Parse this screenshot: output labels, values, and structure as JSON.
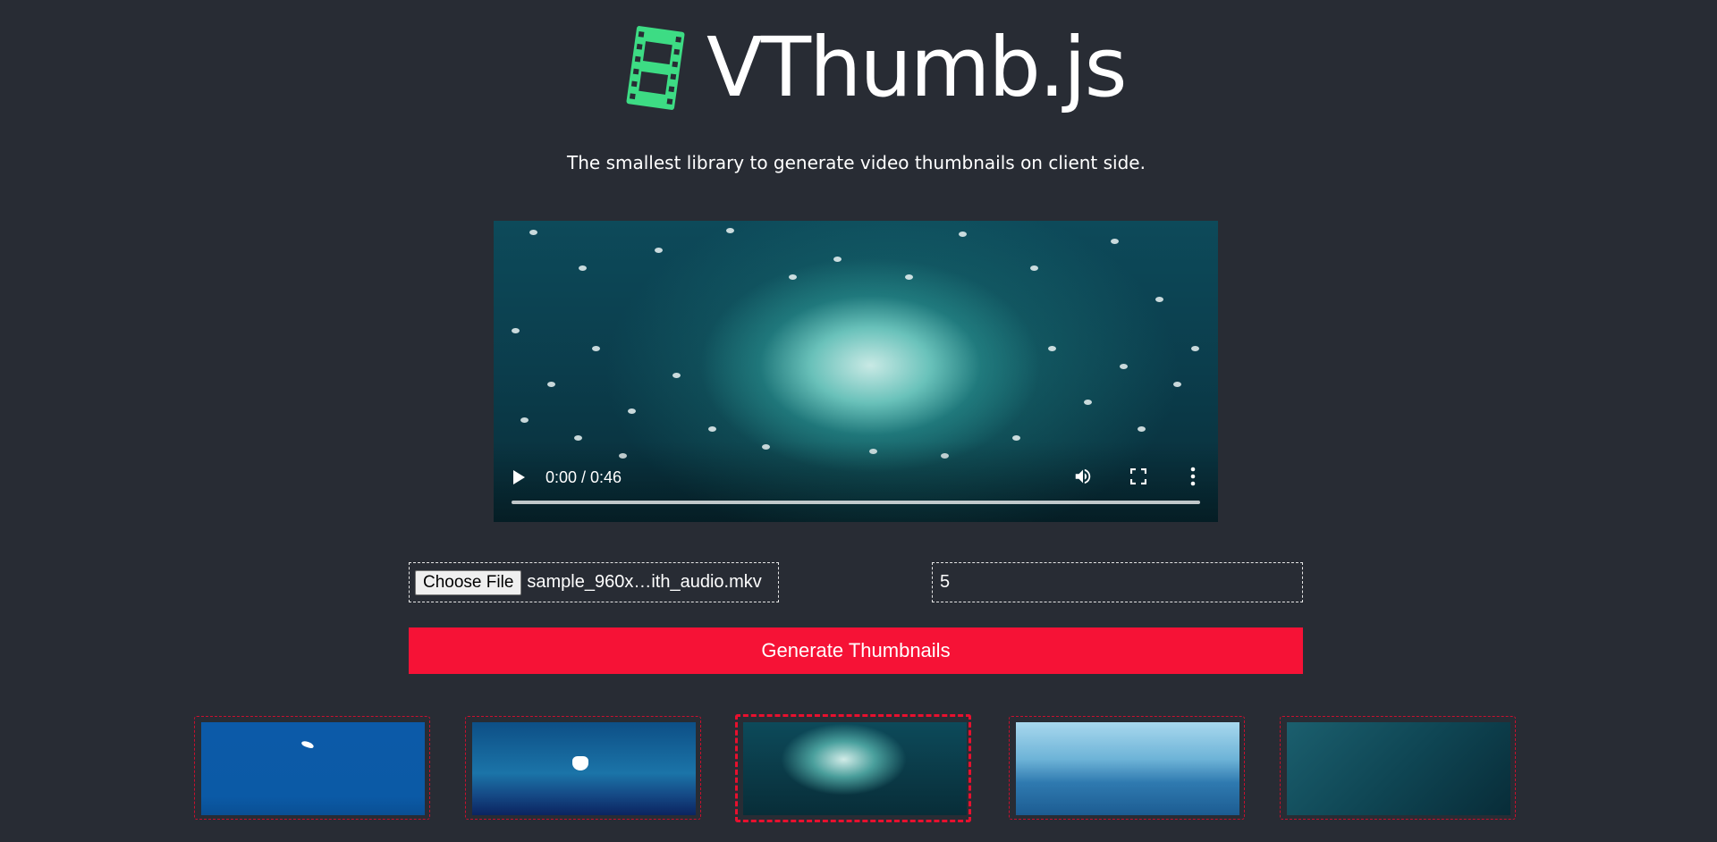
{
  "header": {
    "logo_text": "VThumb.js",
    "tagline": "The smallest library to generate video thumbnails on client side.",
    "logo_icon": "film-strip-icon",
    "accent_color": "#3ddc84"
  },
  "video": {
    "time_display": "0:00 / 0:46",
    "controls": [
      "play-icon",
      "volume-icon",
      "fullscreen-icon",
      "more-vert-icon"
    ]
  },
  "form": {
    "choose_file_label": "Choose File",
    "file_name": "sample_960x…ith_audio.mkv",
    "count_value": "5",
    "generate_label": "Generate Thumbnails",
    "button_color": "#f61236"
  },
  "thumbnails": {
    "count": 5,
    "selected_index": 2
  }
}
